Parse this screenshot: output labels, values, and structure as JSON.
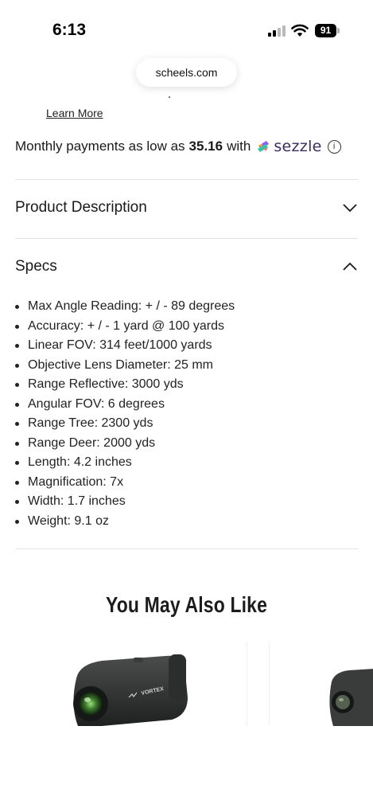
{
  "status_bar": {
    "time": "6:13",
    "battery": "91"
  },
  "browser": {
    "url": "scheels.com"
  },
  "payment": {
    "learn_more": "Learn More",
    "prefix": "Monthly payments as low as",
    "amount": "35.16",
    "with": "with",
    "provider": "sezzle",
    "info_symbol": "i"
  },
  "sections": {
    "product_description": "Product Description",
    "specs": "Specs"
  },
  "specs_items": [
    "Max Angle Reading: + / - 89 degrees",
    "Accuracy: + / - 1 yard @ 100 yards",
    "Linear FOV: 314 feet/1000 yards",
    "Objective Lens Diameter: 25 mm",
    "Range Reflective: 3000 yds",
    "Angular FOV: 6 degrees",
    "Range Tree: 2300 yds",
    "Range Deer: 2000 yds",
    "Length: 4.2 inches",
    "Magnification: 7x",
    "Width: 1.7 inches",
    "Weight: 9.1 oz"
  ],
  "recommendations": {
    "title": "You May Also Like",
    "brand_on_product": "VORTEX"
  },
  "colors": {
    "divider": "#e2e2e2",
    "text": "#1a1a1a",
    "sezzle_text": "#3a2b5e"
  }
}
